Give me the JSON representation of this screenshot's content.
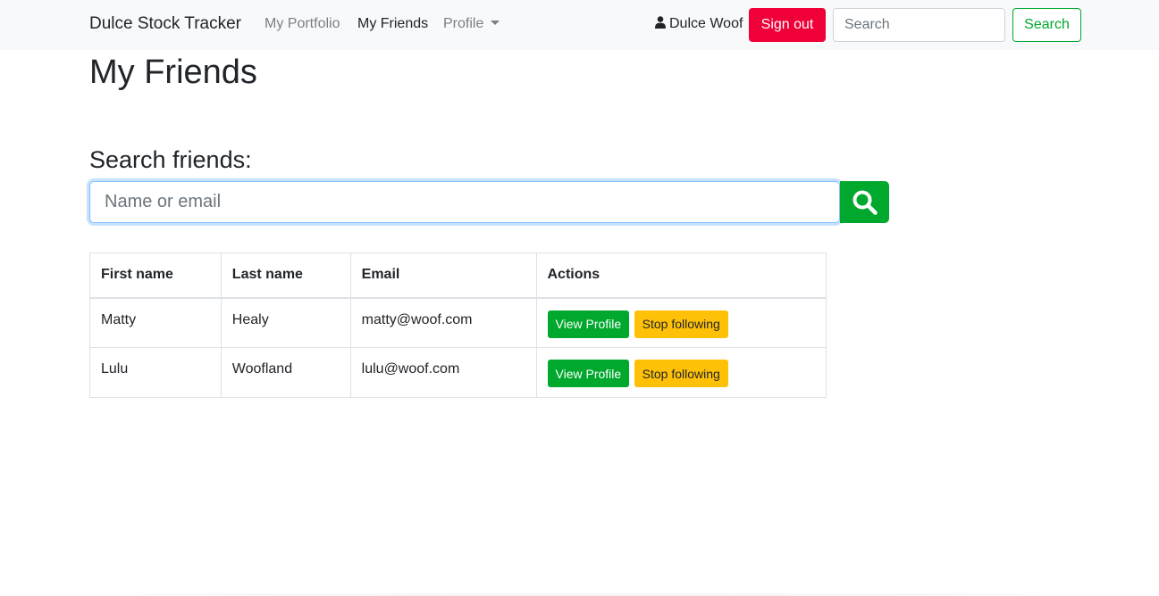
{
  "navbar": {
    "brand": "Dulce Stock Tracker",
    "links": [
      "My Portfolio",
      "My Friends",
      "Profile"
    ],
    "active_link": "My Friends",
    "user_name": "Dulce Woof",
    "sign_out_label": "Sign out",
    "search_placeholder": "Search",
    "search_button_label": "Search"
  },
  "page": {
    "title": "My Friends",
    "search_heading": "Search friends:",
    "search_placeholder": "Name or email"
  },
  "table": {
    "headers": [
      "First name",
      "Last name",
      "Email",
      "Actions"
    ],
    "rows": [
      {
        "first_name": "Matty",
        "last_name": "Healy",
        "email": "matty@woof.com",
        "view_label": "View Profile",
        "stop_label": "Stop following"
      },
      {
        "first_name": "Lulu",
        "last_name": "Woofland",
        "email": "lulu@woof.com",
        "view_label": "View Profile",
        "stop_label": "Stop following"
      }
    ]
  },
  "colors": {
    "primary_green": "#00a82d",
    "danger_red": "#ef0038",
    "warning_yellow": "#ffc107",
    "navbar_bg": "#f8f9fa"
  },
  "icons": {
    "user": "user-icon",
    "search": "search-icon",
    "dropdown": "caret-down-icon"
  }
}
